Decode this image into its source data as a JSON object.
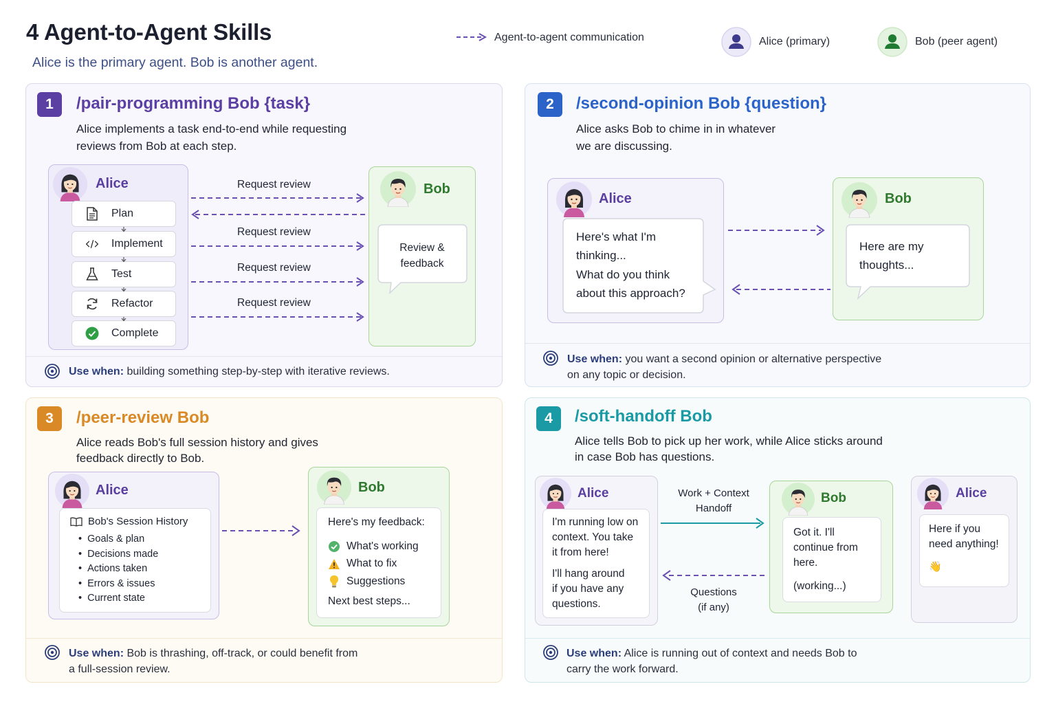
{
  "title": "4 Agent-to-Agent Skills",
  "subtitle": "Alice is the primary agent. Bob is another agent.",
  "legend": {
    "communication": "Agent-to-agent communication",
    "alice": "Alice (primary)",
    "bob": "Bob (peer agent)"
  },
  "colors": {
    "purple": "#5b3fa3",
    "blue": "#2b63c9",
    "orange": "#d98a26",
    "teal": "#1a9aa5",
    "arrow": "#6a50b3"
  },
  "use_when_label": "Use when:",
  "panel1": {
    "num": "1",
    "command": "/pair-programming Bob {task}",
    "desc1": "Alice implements a task end-to-end while requesting",
    "desc2": "reviews from Bob at each step.",
    "alice": "Alice",
    "bob": "Bob",
    "steps": [
      "Plan",
      "Implement",
      "Test",
      "Refactor",
      "Complete"
    ],
    "arrow_label": "Request review",
    "bob_bubble1": "Review &",
    "bob_bubble2": "feedback",
    "use_when": "building something step-by-step with iterative reviews."
  },
  "panel2": {
    "num": "2",
    "command": "/second-opinion Bob {question}",
    "desc1": "Alice asks Bob to chime in in whatever",
    "desc2": "we are discussing.",
    "alice": "Alice",
    "bob": "Bob",
    "alice_lines": [
      "Here's what I'm",
      "thinking...",
      "What do you think",
      "about this approach?"
    ],
    "bob_lines": [
      "Here are my",
      "thoughts..."
    ],
    "use_when1": "you want a second opinion or alternative perspective",
    "use_when2": "on any topic or decision."
  },
  "panel3": {
    "num": "3",
    "command": "/peer-review Bob",
    "desc1": "Alice reads Bob's full session history and gives",
    "desc2": "feedback directly to Bob.",
    "alice": "Alice",
    "bob": "Bob",
    "history_title": "Bob's Session History",
    "history_items": [
      "Goals & plan",
      "Decisions made",
      "Actions taken",
      "Errors & issues",
      "Current state"
    ],
    "feedback_title": "Here's my feedback:",
    "feedback_items": [
      "What's working",
      "What to fix",
      "Suggestions"
    ],
    "feedback_next": "Next best steps...",
    "use_when1": "Bob is thrashing, off-track, or could benefit from",
    "use_when2": "a full-session review."
  },
  "panel4": {
    "num": "4",
    "command": "/soft-handoff Bob",
    "desc1": "Alice tells Bob to pick up her work, while Alice sticks around",
    "desc2": "in case Bob has questions.",
    "alice": "Alice",
    "bob": "Bob",
    "alice2": "Alice",
    "alice_lines_a": [
      "I'm running low on",
      "context. You take",
      "it from here!"
    ],
    "alice_lines_b": [
      "I'll hang around",
      "if you have any",
      "questions."
    ],
    "handoff_label1": "Work + Context",
    "handoff_label2": "Handoff",
    "questions_label1": "Questions",
    "questions_label2": "(if any)",
    "bob_lines": [
      "Got it. I'll",
      "continue from",
      "here."
    ],
    "bob_working": "(working...)",
    "alice2_lines": [
      "Here if you",
      "need anything!"
    ],
    "wave": "👋",
    "use_when1": "Alice is running out of context and needs Bob to",
    "use_when2": "carry the work forward."
  }
}
